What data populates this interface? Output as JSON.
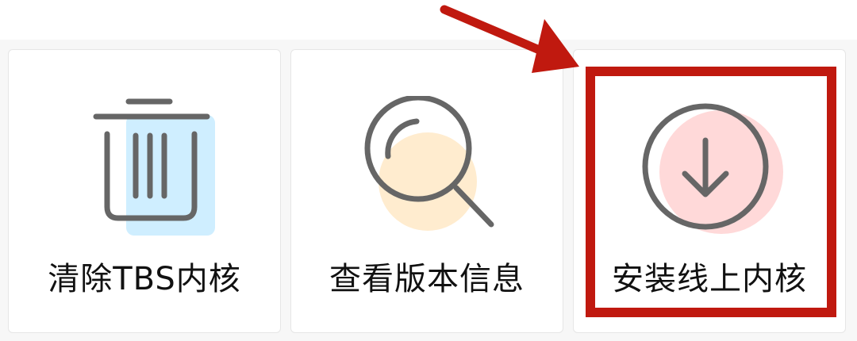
{
  "cards": [
    {
      "label": "清除TBS内核",
      "icon": "trash-icon",
      "accent": "#cfeeff"
    },
    {
      "label": "查看版本信息",
      "icon": "magnifier-icon",
      "accent": "#ffeccf"
    },
    {
      "label": "安装线上内核",
      "icon": "download-circle-icon",
      "accent": "#ffd9d9"
    }
  ],
  "annotation": {
    "highlight_color": "#c0190f",
    "highlighted_card": "安装线上内核"
  }
}
